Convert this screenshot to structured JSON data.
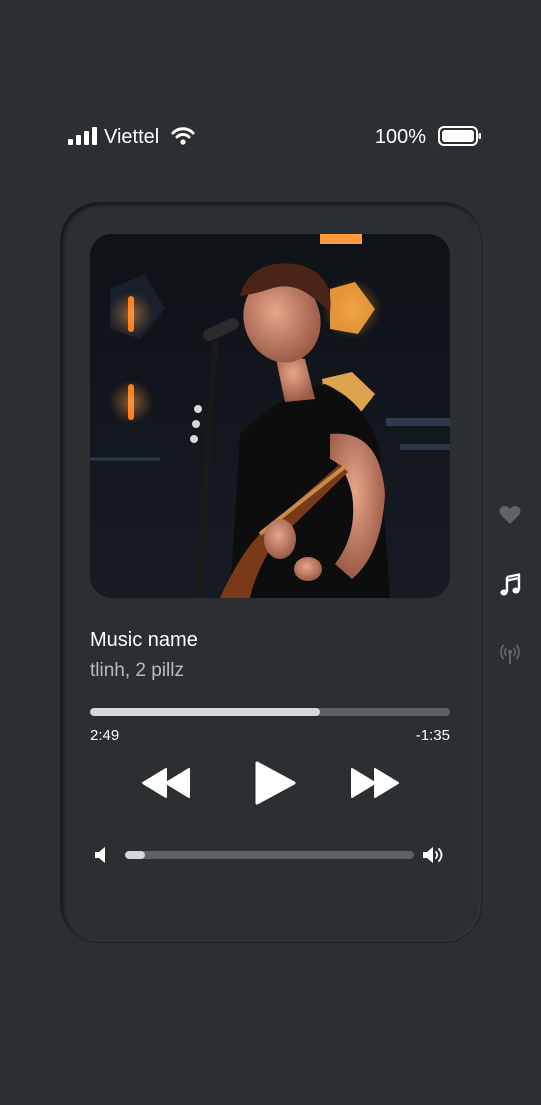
{
  "status_bar": {
    "carrier": "Viettel",
    "battery_percent": "100%"
  },
  "player": {
    "song_title": "Music name",
    "artist": "tlinh, 2 pillz",
    "progress": 0.64,
    "time_elapsed": "2:49",
    "time_remaining": "-1:35",
    "volume": 0.07
  },
  "side_nav": {
    "items": [
      {
        "icon": "heart-icon",
        "active": false
      },
      {
        "icon": "music-note-icon",
        "active": true
      },
      {
        "icon": "broadcast-icon",
        "active": false
      }
    ]
  },
  "colors": {
    "background": "#2b2f31",
    "track": "#5c6165",
    "fill": "#d4d6d7",
    "inactive_icon": "#5f6468"
  }
}
